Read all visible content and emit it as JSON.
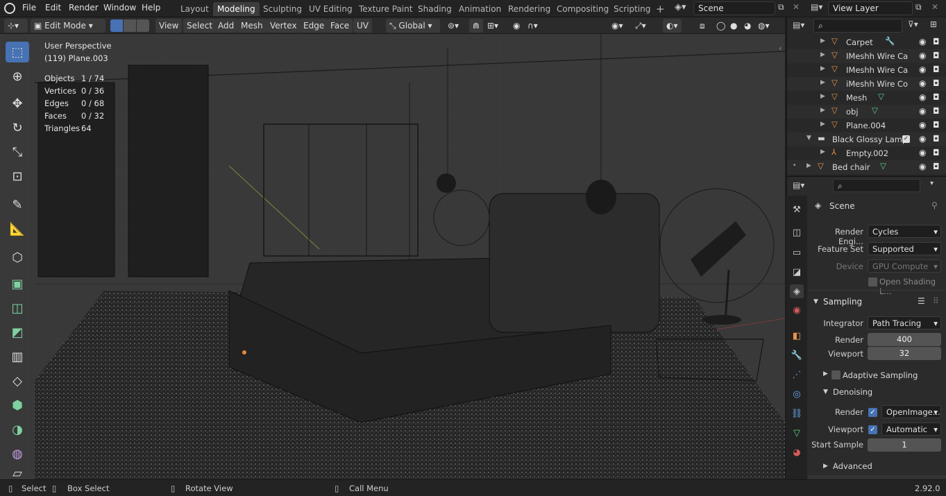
{
  "topbar": {
    "menus": [
      "File",
      "Edit",
      "Render",
      "Window",
      "Help"
    ],
    "workspaces": [
      "Layout",
      "Modeling",
      "Sculpting",
      "UV Editing",
      "Texture Paint",
      "Shading",
      "Animation",
      "Rendering",
      "Compositing",
      "Scripting"
    ],
    "active_workspace": "Modeling",
    "add_tab": "+",
    "scene": "Scene",
    "view_layer": "View Layer"
  },
  "view_header": {
    "mode": "Edit Mode",
    "menus": [
      "View",
      "Select",
      "Add",
      "Mesh",
      "Vertex",
      "Edge",
      "Face",
      "UV"
    ],
    "orientation": "Global"
  },
  "overlay": {
    "perspective": "User Perspective",
    "object": "(119) Plane.003",
    "stats": [
      {
        "label": "Objects",
        "value": "1 / 74"
      },
      {
        "label": "Vertices",
        "value": "0 / 36"
      },
      {
        "label": "Edges",
        "value": "0 / 68"
      },
      {
        "label": "Faces",
        "value": "0 / 32"
      },
      {
        "label": "Triangles",
        "value": "64"
      }
    ]
  },
  "outliner": {
    "items": [
      {
        "name": "Carpet",
        "type": "object"
      },
      {
        "name": "IMeshh Wire Ca",
        "type": "object"
      },
      {
        "name": "IMeshh Wire Ca",
        "type": "object"
      },
      {
        "name": "iMeshh Wire Co",
        "type": "object"
      },
      {
        "name": "Mesh",
        "type": "object"
      },
      {
        "name": "obj",
        "type": "object"
      },
      {
        "name": "Plane.004",
        "type": "object"
      },
      {
        "name": "Black Glossy Lamp",
        "type": "collection"
      },
      {
        "name": "Empty.002",
        "type": "empty"
      },
      {
        "name": "Bed chair",
        "type": "object"
      }
    ]
  },
  "properties": {
    "context": "Scene",
    "render_engine_label": "Render Engi...",
    "render_engine": "Cycles",
    "feature_set_label": "Feature Set",
    "feature_set": "Supported",
    "device_label": "Device",
    "device": "GPU Compute",
    "open_shading": "Open Shading L...",
    "sampling_title": "Sampling",
    "integrator_label": "Integrator",
    "integrator": "Path Tracing",
    "render_label": "Render",
    "render_samples": "400",
    "viewport_label": "Viewport",
    "viewport_samples": "32",
    "adaptive_sampling": "Adaptive Sampling",
    "denoising_title": "Denoising",
    "denoise_render_label": "Render",
    "denoise_render": "OpenImage...",
    "denoise_viewport_label": "Viewport",
    "denoise_viewport": "Automatic",
    "start_sample_label": "Start Sample",
    "start_sample": "1",
    "advanced": "Advanced"
  },
  "status": {
    "select": "Select",
    "box_select": "Box Select",
    "rotate": "Rotate View",
    "call_menu": "Call Menu",
    "version": "2.92.0"
  },
  "colors": {
    "accent": "#4772b3",
    "object_icon": "#e8944a",
    "mesh_icon": "#5fd08a"
  }
}
